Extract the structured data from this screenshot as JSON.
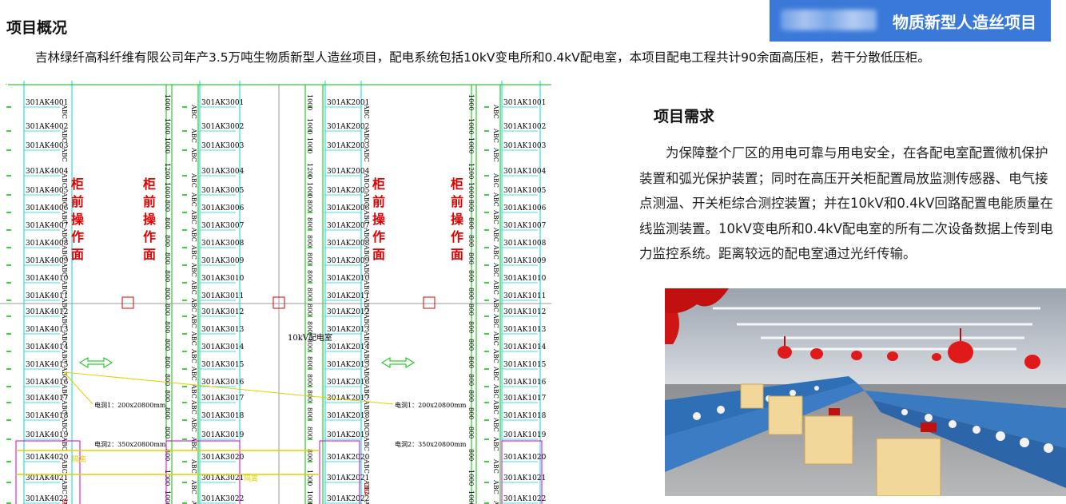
{
  "overview": {
    "title": "项目概况",
    "text": "吉林绿纤高科纤维有限公司年产3.5万吨生物质新型人造丝项目，配电系统包括10kV变电所和0.4kV配电室，本项目配电工程共计90余面高压柜，若干分散低压柜。"
  },
  "banner": {
    "title": "物质新型人造丝项目"
  },
  "requirements": {
    "title": "项目需求",
    "text": "为保障整个厂区的用电可靠与用电安全，在各配电室配置微机保护装置和弧光保护装置；同时在高压开关柜配置局放监测传感器、电气接点测温、开关柜综合测控装置；并在10kV和0.4kV回路配置电能质量在线监测装置。10kV变电所和0.4kV配电室的所有二次设备数据上传到电力监控系统。距离较远的配电室通过光纤传输。"
  },
  "drawing": {
    "front_label": "柜前操作面",
    "room_label": "10kV配电室",
    "abc": "ABC",
    "cba": "CBA",
    "cable_hole_1": "电洞1：200x20800mm",
    "cable_hole_2": "电洞2：350x20800mm",
    "trench": "隔离",
    "columns": [
      {
        "prefix": "301AK40",
        "widths": [
          "1000",
          "1000",
          "1000",
          "1200",
          "1000",
          "800",
          "800",
          "800",
          "800",
          "800",
          "800",
          "800",
          "800",
          "800",
          "800",
          "800",
          "800",
          "800",
          "800",
          "800",
          "1000",
          "1000"
        ]
      },
      {
        "prefix": "301AK30",
        "widths": [
          "1000",
          "1000",
          "1000",
          "1200",
          "1000",
          "800",
          "800",
          "800",
          "800",
          "800",
          "800",
          "800",
          "800",
          "800",
          "800",
          "800",
          "800",
          "800",
          "800",
          "800",
          "1000",
          "1000"
        ]
      },
      {
        "prefix": "301AK20",
        "widths": [
          "1000",
          "1000",
          "1000",
          "1200",
          "1000",
          "800",
          "800",
          "800",
          "800",
          "800",
          "800",
          "800",
          "800",
          "800",
          "800",
          "800",
          "800",
          "800",
          "800",
          "800",
          "1000",
          "1000"
        ]
      },
      {
        "prefix": "301AK10",
        "widths": [
          "1000",
          "1000",
          "1000",
          "1200",
          "1000",
          "800",
          "800",
          "800",
          "800",
          "800",
          "800",
          "800",
          "800",
          "800",
          "800",
          "800",
          "800",
          "800",
          "800",
          "800",
          "1000",
          "1000"
        ]
      }
    ]
  },
  "colors": {
    "banner": "#3b79d9",
    "cad_green": "#00c000",
    "cad_cyan": "#00d8d8",
    "cad_red": "#e00000",
    "cad_magenta": "#d000d0",
    "cad_yellow": "#e0d000"
  }
}
